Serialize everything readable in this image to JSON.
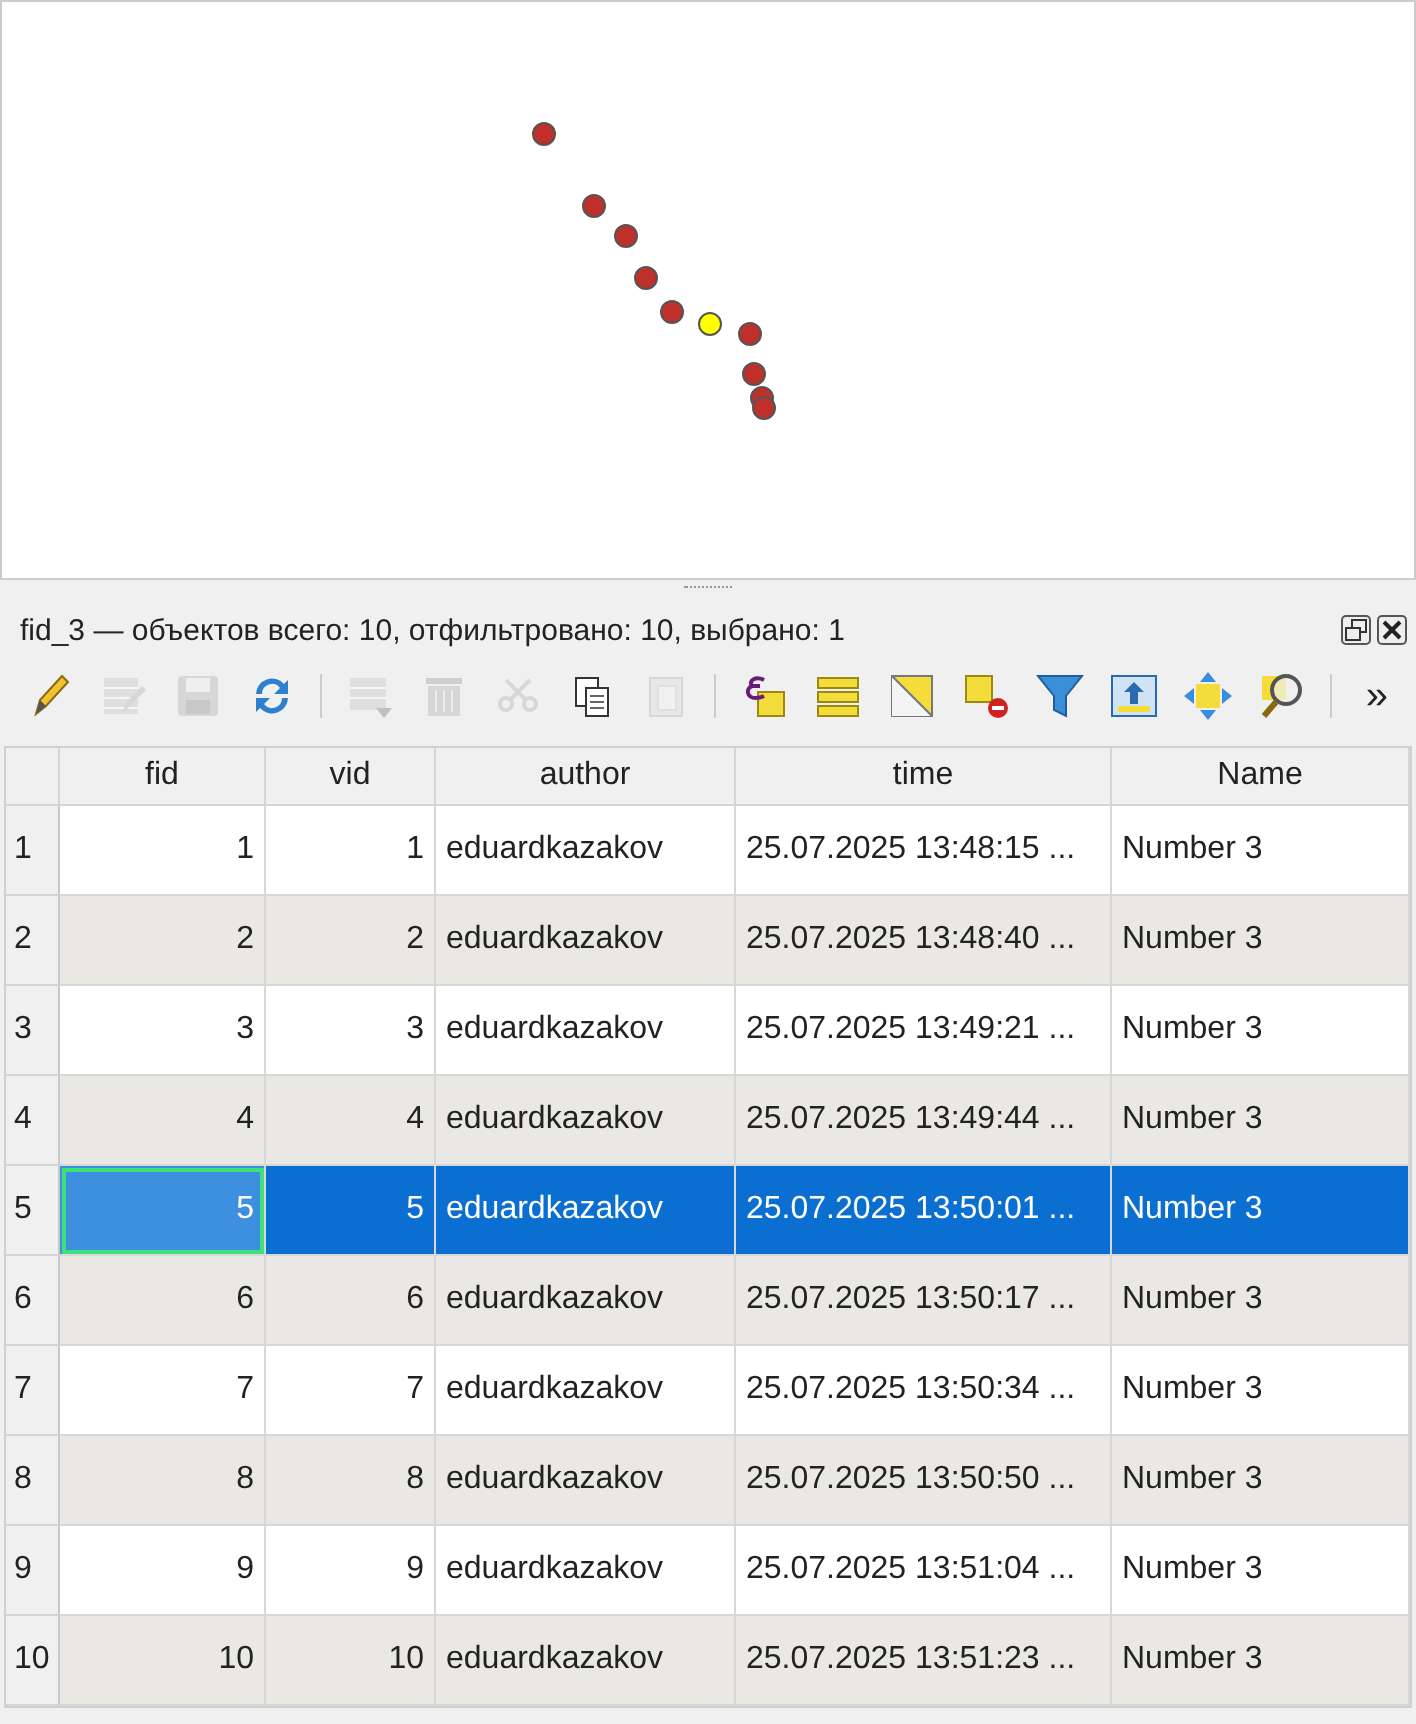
{
  "map": {
    "kind": "points"
  },
  "panel": {
    "title": "fid_3 — объектов всего: 10, отфильтровано: 10, выбрано: 1"
  },
  "toolbar": {
    "tools": [
      {
        "kind": "pencil",
        "disabled": false
      },
      {
        "kind": "multi-edit",
        "disabled": true
      },
      {
        "kind": "save",
        "disabled": true
      },
      {
        "kind": "refresh",
        "disabled": false
      },
      {
        "kind": "separator"
      },
      {
        "kind": "add-row",
        "disabled": true
      },
      {
        "kind": "trash",
        "disabled": true
      },
      {
        "kind": "scissors",
        "disabled": true
      },
      {
        "kind": "copy",
        "disabled": false
      },
      {
        "kind": "paste",
        "disabled": true
      },
      {
        "kind": "separator"
      },
      {
        "kind": "expression",
        "disabled": false
      },
      {
        "kind": "select-all",
        "disabled": false
      },
      {
        "kind": "invert",
        "disabled": false
      },
      {
        "kind": "deselect",
        "disabled": false
      },
      {
        "kind": "filter",
        "disabled": false
      },
      {
        "kind": "move-top",
        "disabled": false
      },
      {
        "kind": "pan",
        "disabled": false
      },
      {
        "kind": "zoom",
        "disabled": false
      },
      {
        "kind": "separator"
      }
    ],
    "more": "»"
  },
  "table": {
    "columns": [
      "fid",
      "vid",
      "author",
      "time",
      "Name"
    ],
    "rows": [
      {
        "number": "1",
        "cells": [
          "1",
          "1",
          "eduardkazakov",
          "25.07.2025 13:48:15 ...",
          "Number 3"
        ],
        "selected": false,
        "focused": false
      },
      {
        "number": "2",
        "cells": [
          "2",
          "2",
          "eduardkazakov",
          "25.07.2025 13:48:40 ...",
          "Number 3"
        ],
        "selected": false,
        "focused": false
      },
      {
        "number": "3",
        "cells": [
          "3",
          "3",
          "eduardkazakov",
          "25.07.2025 13:49:21 ...",
          "Number 3"
        ],
        "selected": false,
        "focused": false
      },
      {
        "number": "4",
        "cells": [
          "4",
          "4",
          "eduardkazakov",
          "25.07.2025 13:49:44 ...",
          "Number 3"
        ],
        "selected": false,
        "focused": false
      },
      {
        "number": "5",
        "cells": [
          "5",
          "5",
          "eduardkazakov",
          "25.07.2025 13:50:01 ...",
          "Number 3"
        ],
        "selected": true,
        "focused": true
      },
      {
        "number": "6",
        "cells": [
          "6",
          "6",
          "eduardkazakov",
          "25.07.2025 13:50:17 ...",
          "Number 3"
        ],
        "selected": false,
        "focused": false
      },
      {
        "number": "7",
        "cells": [
          "7",
          "7",
          "eduardkazakov",
          "25.07.2025 13:50:34 ...",
          "Number 3"
        ],
        "selected": false,
        "focused": false
      },
      {
        "number": "8",
        "cells": [
          "8",
          "8",
          "eduardkazakov",
          "25.07.2025 13:50:50 ...",
          "Number 3"
        ],
        "selected": false,
        "focused": false
      },
      {
        "number": "9",
        "cells": [
          "9",
          "9",
          "eduardkazakov",
          "25.07.2025 13:51:04 ...",
          "Number 3"
        ],
        "selected": false,
        "focused": false
      },
      {
        "number": "10",
        "cells": [
          "10",
          "10",
          "eduardkazakov",
          "25.07.2025 13:51:23 ...",
          "Number 3"
        ],
        "selected": false,
        "focused": false
      }
    ]
  }
}
